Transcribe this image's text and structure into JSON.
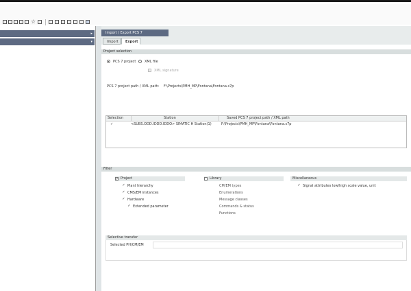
{
  "toolbar": {
    "icons": [
      "new-icon",
      "open-icon",
      "save-icon",
      "properties-icon",
      "window-icon",
      "star-icon",
      "home-icon",
      "compile-icon",
      "wizard-icon",
      "check-icon",
      "download-icon",
      "edit-icon",
      "export-icon",
      "import-icon"
    ]
  },
  "sidebar": {
    "arrow_1": "▸",
    "arrow_2": "▾"
  },
  "document_tab": {
    "title": "Import / Export PCS 7"
  },
  "tabs": [
    {
      "label": "Import",
      "active": false
    },
    {
      "label": "Export",
      "active": true
    }
  ],
  "project_selection": {
    "heading": "Project selection",
    "option_pcs7": "PCS 7 project",
    "option_xml": "XML file",
    "xml_signature": "XML signature",
    "path_label": "PCS 7 project path / XML path:",
    "path_value": "F:\\Projects\\PMH_MP\\Fontana\\Fontana.s7p"
  },
  "grid": {
    "columns": [
      "Selection",
      "Station",
      "Saved PCS 7 project path / XML path"
    ],
    "rows": [
      {
        "checked": "✓",
        "station": "<SUBS.ODD.IDDD.IDDO> SIMATIC H Station(1)",
        "path": "F:\\Projects\\PMH_MP\\Fontana\\Fontana.s7p"
      }
    ]
  },
  "filter": {
    "heading": "Filter",
    "project": {
      "label": "Project",
      "checked": true,
      "items": [
        {
          "label": "Plant hierarchy",
          "checked": true
        },
        {
          "label": "CMS/EM instances",
          "checked": true
        },
        {
          "label": "Hardware",
          "checked": true
        },
        {
          "label": "Extended parameter",
          "checked": true
        }
      ]
    },
    "library": {
      "label": "Library",
      "checked": false,
      "items": [
        "CM/EM types",
        "Enumerations",
        "Message classes",
        "Commands & status",
        "Functions"
      ]
    },
    "miscellaneous": {
      "label": "Miscellaneous",
      "items": [
        {
          "label": "Signal attributes low/high scale value, unit",
          "checked": true
        }
      ]
    }
  },
  "selective_transfer": {
    "heading": "Selective transfer",
    "label": "Selected PH/CM/EM"
  }
}
